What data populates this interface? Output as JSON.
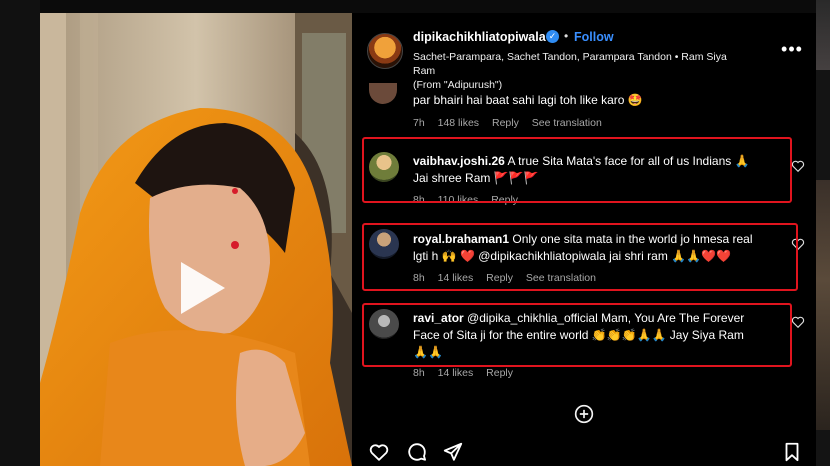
{
  "post": {
    "username": "dipikachikhliatopiwala",
    "follow_label": "Follow",
    "separator": "•",
    "audio_line1": "Sachet-Parampara, Sachet Tandon, Parampara Tandon • Ram Siya Ram",
    "audio_line2": "(From \"Adipurush\")",
    "more_label": "•••"
  },
  "comments": [
    {
      "text": "par bhairi hai baat sahi lagi toh like karo 🤩",
      "time": "7h",
      "likes": "148 likes",
      "reply": "Reply",
      "translate": "See translation"
    },
    {
      "username": "vaibhav.joshi.26",
      "line1": "A true Sita Mata's face for all of us Indians 🙏",
      "line2": "Jai shree Ram 🚩🚩🚩",
      "time": "8h",
      "likes": "110 likes",
      "reply": "Reply"
    },
    {
      "username": "royal.brahaman1",
      "line1": "Only one sita mata in the world jo hmesa real",
      "line2": "lgti h 🙌 ❤️  @dipikachikhliatopiwala jai shri ram 🙏🙏❤️❤️",
      "time": "8h",
      "likes": "14 likes",
      "reply": "Reply",
      "translate": "See translation"
    },
    {
      "username": "ravi_ator",
      "line1": "@dipika_chikhlia_official Mam, You Are The Forever",
      "line2": "Face of Sita ji for the entire world 👏👏👏🙏🙏  Jay Siya Ram",
      "line3": "🙏🙏",
      "time": "8h",
      "likes": "14 likes",
      "reply": "Reply"
    }
  ],
  "icons": {
    "play": "play-icon",
    "verified": "verified-badge-icon",
    "heart": "heart-icon",
    "add": "add-circle-icon",
    "like": "heart-outline-icon",
    "comment": "comment-icon",
    "share": "share-paper-plane-icon",
    "save": "bookmark-icon"
  },
  "colors": {
    "accent": "#3a8fff",
    "highlight": "#e0141e",
    "background": "#000000"
  }
}
